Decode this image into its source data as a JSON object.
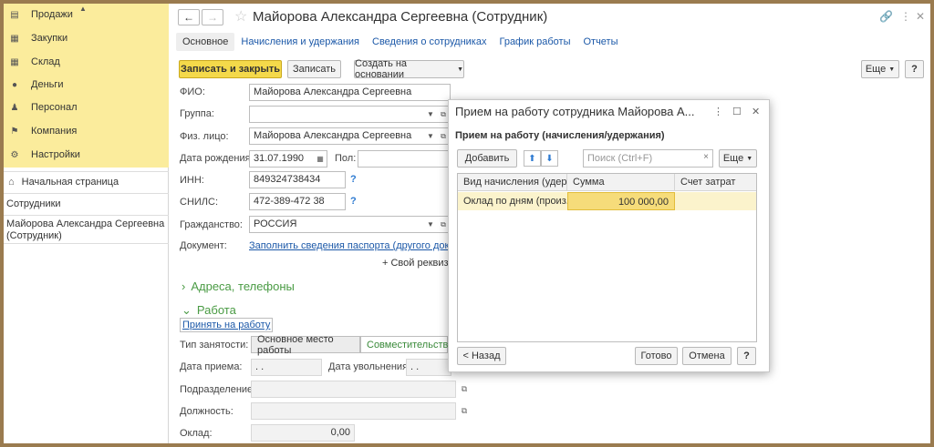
{
  "sidebar": {
    "sections": [
      {
        "label": "Продажи",
        "icon": "sales-icon"
      },
      {
        "label": "Закупки",
        "icon": "purchases-icon"
      },
      {
        "label": "Склад",
        "icon": "warehouse-icon"
      },
      {
        "label": "Деньги",
        "icon": "money-icon"
      },
      {
        "label": "Персонал",
        "icon": "staff-icon"
      },
      {
        "label": "Компания",
        "icon": "company-icon"
      },
      {
        "label": "Настройки",
        "icon": "settings-icon"
      }
    ],
    "home": "Начальная страница",
    "employees": "Сотрудники",
    "current_doc": "Майорова Александра Сергеевна (Сотрудник)"
  },
  "header": {
    "title": "Майорова Александра Сергеевна (Сотрудник)",
    "tabs": [
      "Основное",
      "Начисления и удержания",
      "Сведения о сотрудниках",
      "График работы",
      "Отчеты"
    ]
  },
  "toolbar": {
    "save_close": "Записать и закрыть",
    "save": "Записать",
    "create_based": "Создать на основании",
    "more": "Еще",
    "help": "?"
  },
  "form": {
    "fio_label": "ФИО:",
    "fio_value": "Майорова Александра Сергеевна",
    "group_label": "Группа:",
    "group_value": "",
    "person_label": "Физ. лицо:",
    "person_value": "Майорова Александра Сергеевна",
    "birth_label": "Дата рождения:",
    "birth_value": "31.07.1990",
    "gender_label": "Пол:",
    "inn_label": "ИНН:",
    "inn_value": "849324738434",
    "snils_label": "СНИЛС:",
    "snils_value": "472-389-472 38",
    "citizenship_label": "Гражданство:",
    "citizenship_value": "РОССИЯ",
    "document_label": "Документ:",
    "document_link": "Заполнить сведения паспорта (другого документа",
    "requisites_link": "+ Свой реквизит",
    "addresses_section": "Адреса, телефоны",
    "work_section": "Работа",
    "hire_link": "Принять на работу",
    "employment_label": "Тип занятости:",
    "employment_main": "Основное место работы",
    "employment_part": "Совместительство",
    "hire_date_label": "Дата приема:",
    "hire_date_value": " .  .",
    "dismiss_label": "Дата увольнения:",
    "dismiss_value": " .  .",
    "department_label": "Подразделение:",
    "position_label": "Должность:",
    "salary_label": "Оклад:",
    "salary_value": "0,00"
  },
  "dialog": {
    "title": "Прием на работу сотрудника Майорова А...",
    "subtitle": "Прием на работу (начисления/удержания)",
    "add": "Добавить",
    "search_placeholder": "Поиск (Ctrl+F)",
    "more": "Еще",
    "columns": [
      "Вид начисления (удер...",
      "Сумма",
      "Счет затрат"
    ],
    "rows": [
      {
        "type": "Оклад по дням (произ...",
        "amount": "100 000,00",
        "account": ""
      }
    ],
    "back": "< Назад",
    "done": "Готово",
    "cancel": "Отмена",
    "help": "?"
  }
}
